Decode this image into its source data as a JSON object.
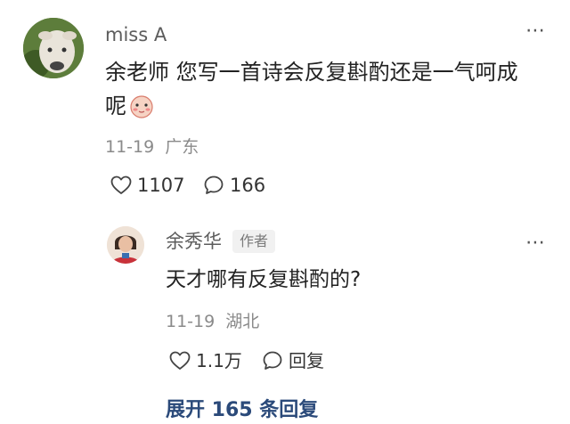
{
  "comment": {
    "username": "miss A",
    "text_line1": "余老师 您写一首诗会反复斟酌还是一气呵成",
    "text_line2": "呢",
    "date": "11-19",
    "location": "广东",
    "likes": "1107",
    "replies": "166",
    "more_icon": "⋯",
    "emoji_icon": "shy-face-emoji"
  },
  "reply": {
    "username": "余秀华",
    "badge": "作者",
    "text": "天才哪有反复斟酌的?",
    "date": "11-19",
    "location": "湖北",
    "likes": "1.1万",
    "reply_label": "回复",
    "more_icon": "⋯"
  },
  "expand": {
    "label": "展开 165 条回复"
  },
  "colors": {
    "text": "#222222",
    "meta": "#8a8a8a",
    "expand": "#2b4a7a"
  }
}
